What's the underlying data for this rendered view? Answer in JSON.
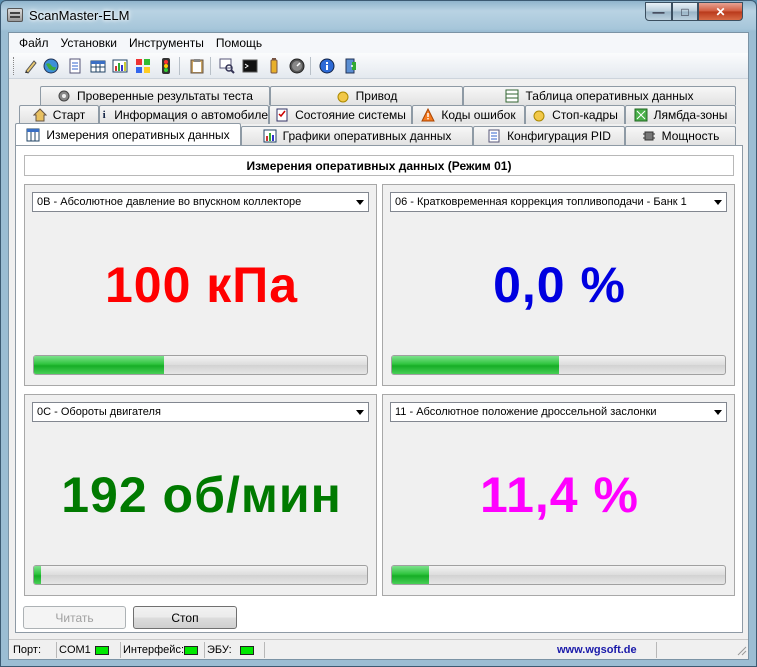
{
  "window": {
    "title": "ScanMaster-ELM"
  },
  "menu": [
    "Файл",
    "Установки",
    "Инструменты",
    "Помощь"
  ],
  "toolbar_icons": [
    "pen-icon",
    "globe-icon",
    "document-icon",
    "table-icon",
    "chart-icon",
    "windows-flag-icon",
    "traffic-light-icon",
    "clipboard-icon",
    "inspect-icon",
    "terminal-icon",
    "battery-icon",
    "gauge-icon",
    "info-icon",
    "exit-door-icon"
  ],
  "tabs": {
    "row1": [
      "Проверенные результаты теста",
      "Привод",
      "Таблица оперативных данных"
    ],
    "row2": [
      "Старт",
      "Информация о автомобиле",
      "Состояние системы",
      "Коды ошибок",
      "Стоп-кадры",
      "Лямбда-зоны"
    ],
    "row3": [
      "Измерения оперативных данных",
      "Графики оперативных данных",
      "Конфигурация PID",
      "Мощность"
    ]
  },
  "panel": {
    "title": "Измерения оперативных данных (Режим 01)"
  },
  "gauges": [
    {
      "pid": "0B - Абсолютное давление во впускном коллекторе",
      "value": "100 кПа",
      "color": "#ff0000",
      "fill": 0.39
    },
    {
      "pid": "06 - Кратковременная коррекция топливоподачи - Банк 1",
      "value": "0,0 %",
      "color": "#0000e0",
      "fill": 0.5
    },
    {
      "pid": "0C - Обороты двигателя",
      "value": "192 об/мин",
      "color": "#007a00",
      "fill": 0.02
    },
    {
      "pid": "11 - Абсолютное положение дроссельной заслонки",
      "value": "11,4 %",
      "color": "#ff00ff",
      "fill": 0.11
    }
  ],
  "buttons": {
    "read": "Читать",
    "stop": "Стоп"
  },
  "status": {
    "port_label": "Порт:",
    "port_value": "COM1",
    "interface_label": "Интерфейс:",
    "ecu_label": "ЭБУ:",
    "website": "www.wgsoft.de",
    "led_color": "#00e800"
  }
}
